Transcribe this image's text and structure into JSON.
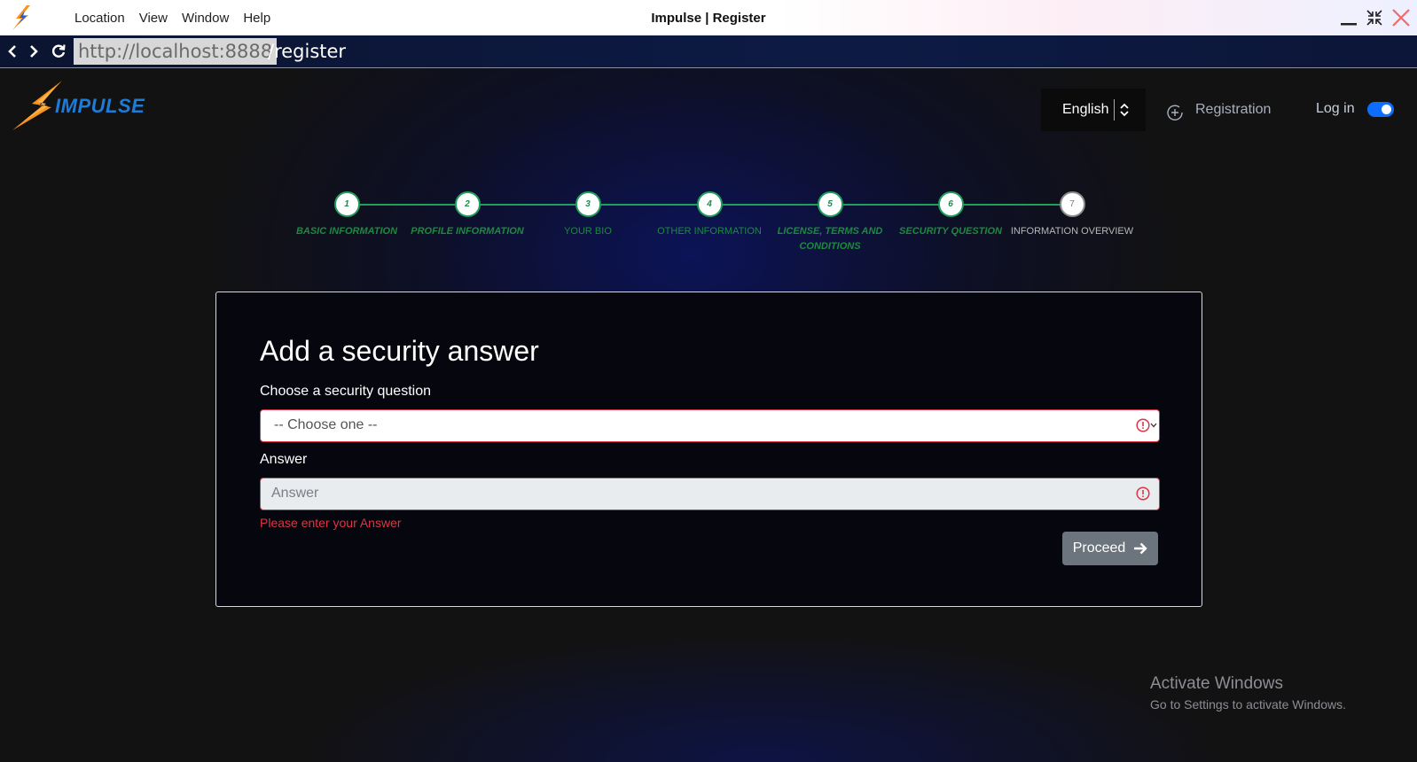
{
  "window": {
    "title": "Impulse | Register",
    "menu": [
      "Location",
      "View",
      "Window",
      "Help"
    ]
  },
  "address": {
    "host": "http://localhost:8888",
    "path": "/register"
  },
  "header": {
    "brand": "IMPULSE",
    "language": "English",
    "registration": "Registration",
    "login": "Log in",
    "login_toggle_on": true
  },
  "steps": [
    {
      "number": "1",
      "label": "BASIC INFORMATION"
    },
    {
      "number": "2",
      "label": "PROFILE INFORMATION"
    },
    {
      "number": "3",
      "label": "YOUR BIO"
    },
    {
      "number": "4",
      "label": "OTHER INFORMATION"
    },
    {
      "number": "5",
      "label": "LICENSE, TERMS AND CONDITIONS"
    },
    {
      "number": "6",
      "label": "SECURITY QUESTION"
    },
    {
      "number": "7",
      "label": "INFORMATION OVERVIEW"
    }
  ],
  "form": {
    "title": "Add a security answer",
    "question_label": "Choose a security question",
    "question_value": "-- Choose one --",
    "answer_label": "Answer",
    "answer_placeholder": "Answer",
    "answer_value": "",
    "error_message": "Please enter your Answer",
    "proceed": "Proceed"
  },
  "watermark": {
    "title": "Activate Windows",
    "subtitle": "Go to Settings to activate Windows."
  },
  "colors": {
    "accent_green": "#1f9e5c",
    "error_red": "#dc3545",
    "toggle_blue": "#0d6efd",
    "brand_blue": "#1e7cd6",
    "brand_orange": "#f7931e"
  }
}
